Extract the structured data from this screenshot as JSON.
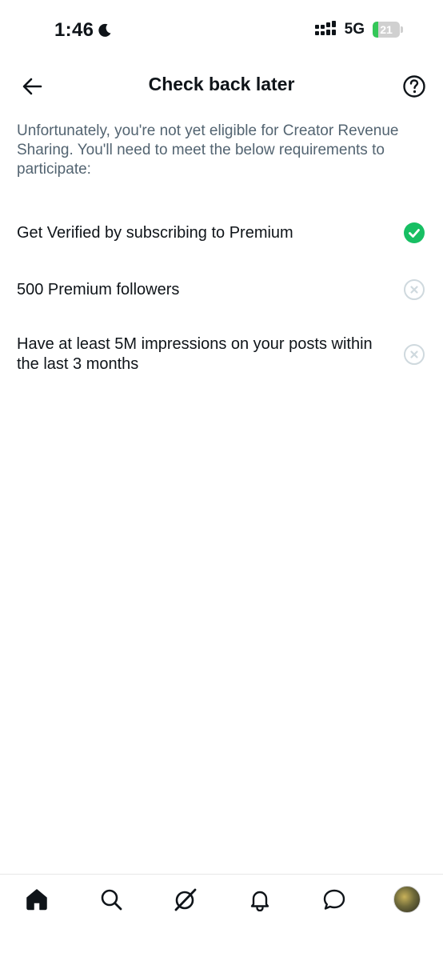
{
  "status_bar": {
    "time": "1:46",
    "network": "5G",
    "battery": "21",
    "battery_level": 0.21
  },
  "header": {
    "title": "Check back later"
  },
  "intro": "Unfortunately, you're not yet eligible for Creator Revenue Sharing. You'll need to meet the below requirements to participate:",
  "requirements": [
    {
      "label": "Get Verified by subscribing to Premium",
      "met": true
    },
    {
      "label": "500 Premium followers",
      "met": false
    },
    {
      "label": "Have at least 5M impressions on your posts within the last 3 months",
      "met": false
    }
  ],
  "colors": {
    "met": "#17bf63",
    "unmet": "#cfd9de",
    "text": "#0f1419",
    "secondary": "#536471"
  },
  "bottom_nav": [
    {
      "icon": "home-icon",
      "active": true
    },
    {
      "icon": "search-icon",
      "active": false
    },
    {
      "icon": "grok-icon",
      "active": false
    },
    {
      "icon": "notifications-icon",
      "active": false
    },
    {
      "icon": "messages-icon",
      "active": false
    },
    {
      "icon": "profile-avatar",
      "active": false
    }
  ]
}
